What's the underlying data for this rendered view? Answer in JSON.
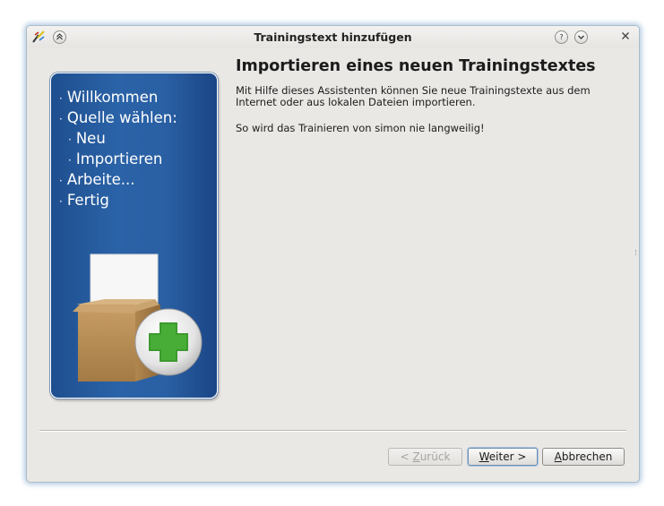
{
  "window": {
    "title": "Trainingstext hinzufügen",
    "icon": "simon-app-icon"
  },
  "titlebar_buttons": {
    "keep_above": "≈",
    "help": "?",
    "minimize": "⌄",
    "close": "✕"
  },
  "sidebar": {
    "steps": [
      {
        "label": "Willkommen",
        "level": 1
      },
      {
        "label": "Quelle wählen:",
        "level": 1
      },
      {
        "label": "Neu",
        "level": 2
      },
      {
        "label": "Importieren",
        "level": 2
      },
      {
        "label": "Arbeite...",
        "level": 1
      },
      {
        "label": "Fertig",
        "level": 1
      }
    ],
    "bullet": "·",
    "image": "box-with-document-and-add-icon"
  },
  "main": {
    "heading": "Importieren eines neuen Trainingstextes",
    "description": "Mit Hilfe dieses Assistenten können Sie neue Trainingstexte aus dem Internet oder aus lokalen Dateien importieren.",
    "description2": "So wird das Trainieren von simon nie langweilig!"
  },
  "buttons": {
    "back": {
      "prefix": "< ",
      "mnemonic": "Z",
      "rest": "urück",
      "enabled": false
    },
    "next": {
      "mnemonic": "W",
      "rest": "eiter >",
      "enabled": true
    },
    "cancel": {
      "mnemonic": "A",
      "rest": "bbrechen",
      "enabled": true
    }
  },
  "colors": {
    "panel_blue": "#2b63a8",
    "window_bg": "#e9e8e5",
    "plus_green": "#3c9a2e"
  }
}
